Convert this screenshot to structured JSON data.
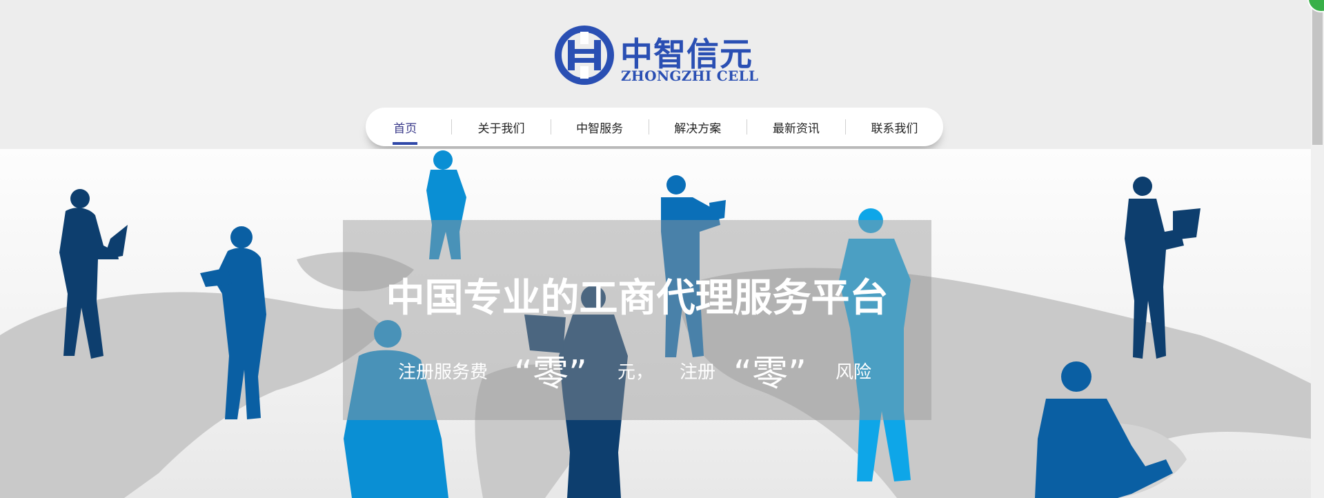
{
  "brand": {
    "name_cn": "中智信元",
    "name_en": "ZHONGZHI CELL",
    "color": "#2a4fb3"
  },
  "nav": {
    "items": [
      {
        "label": "首页",
        "active": true
      },
      {
        "label": "关于我们",
        "active": false
      },
      {
        "label": "中智服务",
        "active": false
      },
      {
        "label": "解决方案",
        "active": false
      },
      {
        "label": "最新资讯",
        "active": false
      },
      {
        "label": "联系我们",
        "active": false
      }
    ]
  },
  "banner": {
    "title": "中国专业的工商代理服务平台",
    "subtitle": {
      "part1": "注册服务费",
      "quote1": "“零”",
      "part2": "元，",
      "part3": "注册",
      "quote2": "“零”",
      "part4": "风险"
    },
    "colors": {
      "dark_blue": "#0d3e6e",
      "mid_blue": "#0a5fa3",
      "light_blue": "#0a8fd4",
      "map_gray": "#c9c9c9"
    }
  },
  "icons": {
    "logo": "logo-mark-icon",
    "corner": "corner-badge-icon"
  }
}
